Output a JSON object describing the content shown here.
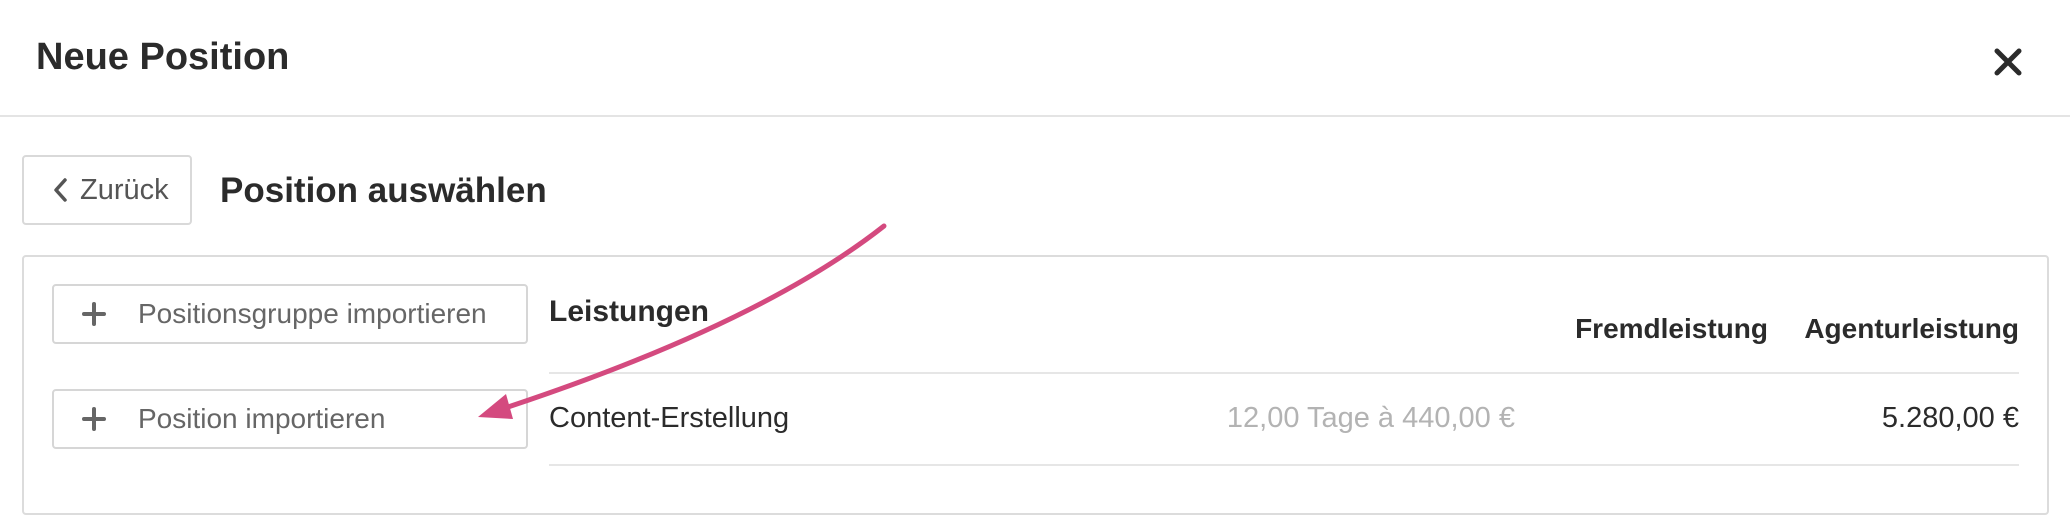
{
  "dialog": {
    "title": "Neue Position",
    "close_icon": "close-icon"
  },
  "toolbar": {
    "back_label": "Zurück",
    "back_icon": "chevron-left-icon",
    "subtitle": "Position auswählen"
  },
  "actions": {
    "import_group_label": "Positionsgruppe importieren",
    "import_position_label": "Position importieren",
    "plus_icon": "plus-icon"
  },
  "table": {
    "section_title": "Leistungen",
    "columns": {
      "external": "Fremdleistung",
      "agency": "Agenturleistung"
    },
    "rows": [
      {
        "name": "Content-Erstellung",
        "detail": "12,00 Tage à 440,00 €",
        "agency_amount": "5.280,00 €"
      }
    ]
  },
  "colors": {
    "annotation_arrow": "#d44a7f",
    "text": "#2b2b2b",
    "muted": "#b3b3b3",
    "border": "#d9d9d9"
  }
}
